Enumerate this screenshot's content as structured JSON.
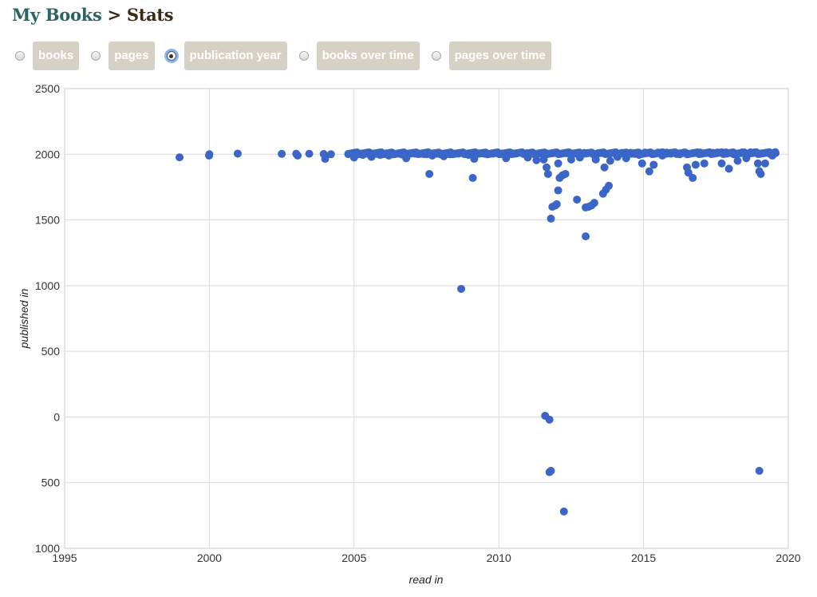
{
  "header": {
    "breadcrumb_root": "My Books",
    "separator": ">",
    "current": "Stats"
  },
  "tabs": [
    {
      "label": "books",
      "checked": false
    },
    {
      "label": "pages",
      "checked": false
    },
    {
      "label": "publication year",
      "checked": true
    },
    {
      "label": "books over time",
      "checked": false
    },
    {
      "label": "pages over time",
      "checked": false
    }
  ],
  "colors": {
    "point": "#3b66c8",
    "grid": "#d9d9d9",
    "tab_bg": "#d5d1c4"
  },
  "chart_data": {
    "type": "scatter",
    "title": "",
    "xlabel": "read in",
    "ylabel": "published in",
    "xlim": [
      1995,
      2020
    ],
    "ylim": [
      -1000,
      2500
    ],
    "grid": true,
    "x_ticks": [
      "1995",
      "2000",
      "2005",
      "2010",
      "2015",
      "2020"
    ],
    "x_tick_values": [
      1995,
      2000,
      2005,
      2010,
      2015,
      2020
    ],
    "y_ticks": [
      "2500",
      "2000",
      "1500",
      "1000",
      "500",
      "0",
      "500",
      "1000"
    ],
    "y_tick_values": [
      2500,
      2000,
      1500,
      1000,
      500,
      0,
      -500,
      -1000
    ],
    "series": [
      {
        "name": "books",
        "points": [
          [
            1998.97,
            1977
          ],
          [
            1999.99,
            1990
          ],
          [
            2000.0,
            2000
          ],
          [
            2000.98,
            2005
          ],
          [
            2002.5,
            2003
          ],
          [
            2003.0,
            2004
          ],
          [
            2003.05,
            1990
          ],
          [
            2003.45,
            2004
          ],
          [
            2003.95,
            2002
          ],
          [
            2004.0,
            1965
          ],
          [
            2004.2,
            2000
          ],
          [
            2004.8,
            2001
          ],
          [
            2004.95,
            1998
          ],
          [
            2005.0,
            1975
          ],
          [
            2005.15,
            2003
          ],
          [
            2005.3,
            1995
          ],
          [
            2005.45,
            2005
          ],
          [
            2005.6,
            1980
          ],
          [
            2005.75,
            2003
          ],
          [
            2005.9,
            1995
          ],
          [
            2006.05,
            2002
          ],
          [
            2006.2,
            1990
          ],
          [
            2006.35,
            2004
          ],
          [
            2006.5,
            2005
          ],
          [
            2006.65,
            1998
          ],
          [
            2006.8,
            1970
          ],
          [
            2006.95,
            2004
          ],
          [
            2007.1,
            2005
          ],
          [
            2007.25,
            2003
          ],
          [
            2007.4,
            2002
          ],
          [
            2007.5,
            2000
          ],
          [
            2007.6,
            1850
          ],
          [
            2007.7,
            1990
          ],
          [
            2007.85,
            2004
          ],
          [
            2008.0,
            2005
          ],
          [
            2008.1,
            1985
          ],
          [
            2008.3,
            2000
          ],
          [
            2008.45,
            2004
          ],
          [
            2008.6,
            2005
          ],
          [
            2008.7,
            975
          ],
          [
            2008.8,
            2003
          ],
          [
            2008.95,
            1995
          ],
          [
            2009.1,
            1820
          ],
          [
            2009.15,
            1965
          ],
          [
            2009.3,
            2006
          ],
          [
            2009.5,
            2004
          ],
          [
            2009.65,
            2002
          ],
          [
            2009.8,
            2005
          ],
          [
            2009.95,
            2007
          ],
          [
            2010.1,
            2003
          ],
          [
            2010.25,
            1970
          ],
          [
            2010.45,
            2008
          ],
          [
            2010.6,
            2006
          ],
          [
            2010.95,
            2007
          ],
          [
            2011.0,
            1975
          ],
          [
            2011.15,
            2009
          ],
          [
            2011.3,
            1955
          ],
          [
            2011.45,
            2008
          ],
          [
            2011.55,
            1960
          ],
          [
            2011.6,
            9
          ],
          [
            2011.65,
            1900
          ],
          [
            2011.7,
            1850
          ],
          [
            2011.75,
            -20
          ],
          [
            2011.75,
            -420
          ],
          [
            2011.8,
            -410
          ],
          [
            2011.8,
            1510
          ],
          [
            2011.85,
            1600
          ],
          [
            2011.95,
            1610
          ],
          [
            2012.0,
            1620
          ],
          [
            2012.05,
            1725
          ],
          [
            2012.05,
            1930
          ],
          [
            2012.1,
            1820
          ],
          [
            2012.2,
            1840
          ],
          [
            2012.25,
            -720
          ],
          [
            2012.3,
            1850
          ],
          [
            2012.35,
            2008
          ],
          [
            2012.5,
            1960
          ],
          [
            2012.6,
            2005
          ],
          [
            2012.7,
            1655
          ],
          [
            2012.8,
            1975
          ],
          [
            2012.95,
            2010
          ],
          [
            2013.0,
            1375
          ],
          [
            2013.0,
            1595
          ],
          [
            2013.1,
            1600
          ],
          [
            2013.2,
            1610
          ],
          [
            2013.3,
            1630
          ],
          [
            2013.35,
            1960
          ],
          [
            2013.45,
            2009
          ],
          [
            2013.6,
            1700
          ],
          [
            2013.65,
            1900
          ],
          [
            2013.7,
            1730
          ],
          [
            2013.8,
            1760
          ],
          [
            2013.85,
            1950
          ],
          [
            2013.95,
            2010
          ],
          [
            2014.1,
            1980
          ],
          [
            2014.25,
            2010
          ],
          [
            2014.4,
            1970
          ],
          [
            2014.55,
            2011
          ],
          [
            2014.7,
            2003
          ],
          [
            2014.85,
            1995
          ],
          [
            2014.95,
            1930
          ],
          [
            2015.05,
            2012
          ],
          [
            2015.2,
            1870
          ],
          [
            2015.35,
            1920
          ],
          [
            2015.5,
            2012
          ],
          [
            2015.65,
            1990
          ],
          [
            2015.8,
            2012
          ],
          [
            2015.95,
            2005
          ],
          [
            2016.1,
            2012
          ],
          [
            2016.25,
            2000
          ],
          [
            2016.4,
            2013
          ],
          [
            2016.5,
            1900
          ],
          [
            2016.55,
            1860
          ],
          [
            2016.7,
            1820
          ],
          [
            2016.8,
            1920
          ],
          [
            2016.95,
            2013
          ],
          [
            2017.1,
            1930
          ],
          [
            2017.25,
            2012
          ],
          [
            2017.4,
            2010
          ],
          [
            2017.55,
            2013
          ],
          [
            2017.7,
            1930
          ],
          [
            2017.85,
            2014
          ],
          [
            2017.95,
            1890
          ],
          [
            2018.1,
            2014
          ],
          [
            2018.25,
            1950
          ],
          [
            2018.4,
            2014
          ],
          [
            2018.55,
            1970
          ],
          [
            2018.7,
            2015
          ],
          [
            2018.85,
            2015
          ],
          [
            2018.95,
            1930
          ],
          [
            2019.0,
            -410
          ],
          [
            2019.0,
            1870
          ],
          [
            2019.05,
            1850
          ],
          [
            2019.2,
            1930
          ],
          [
            2019.35,
            2015
          ],
          [
            2019.45,
            1990
          ],
          [
            2019.55,
            2016
          ]
        ]
      }
    ]
  }
}
